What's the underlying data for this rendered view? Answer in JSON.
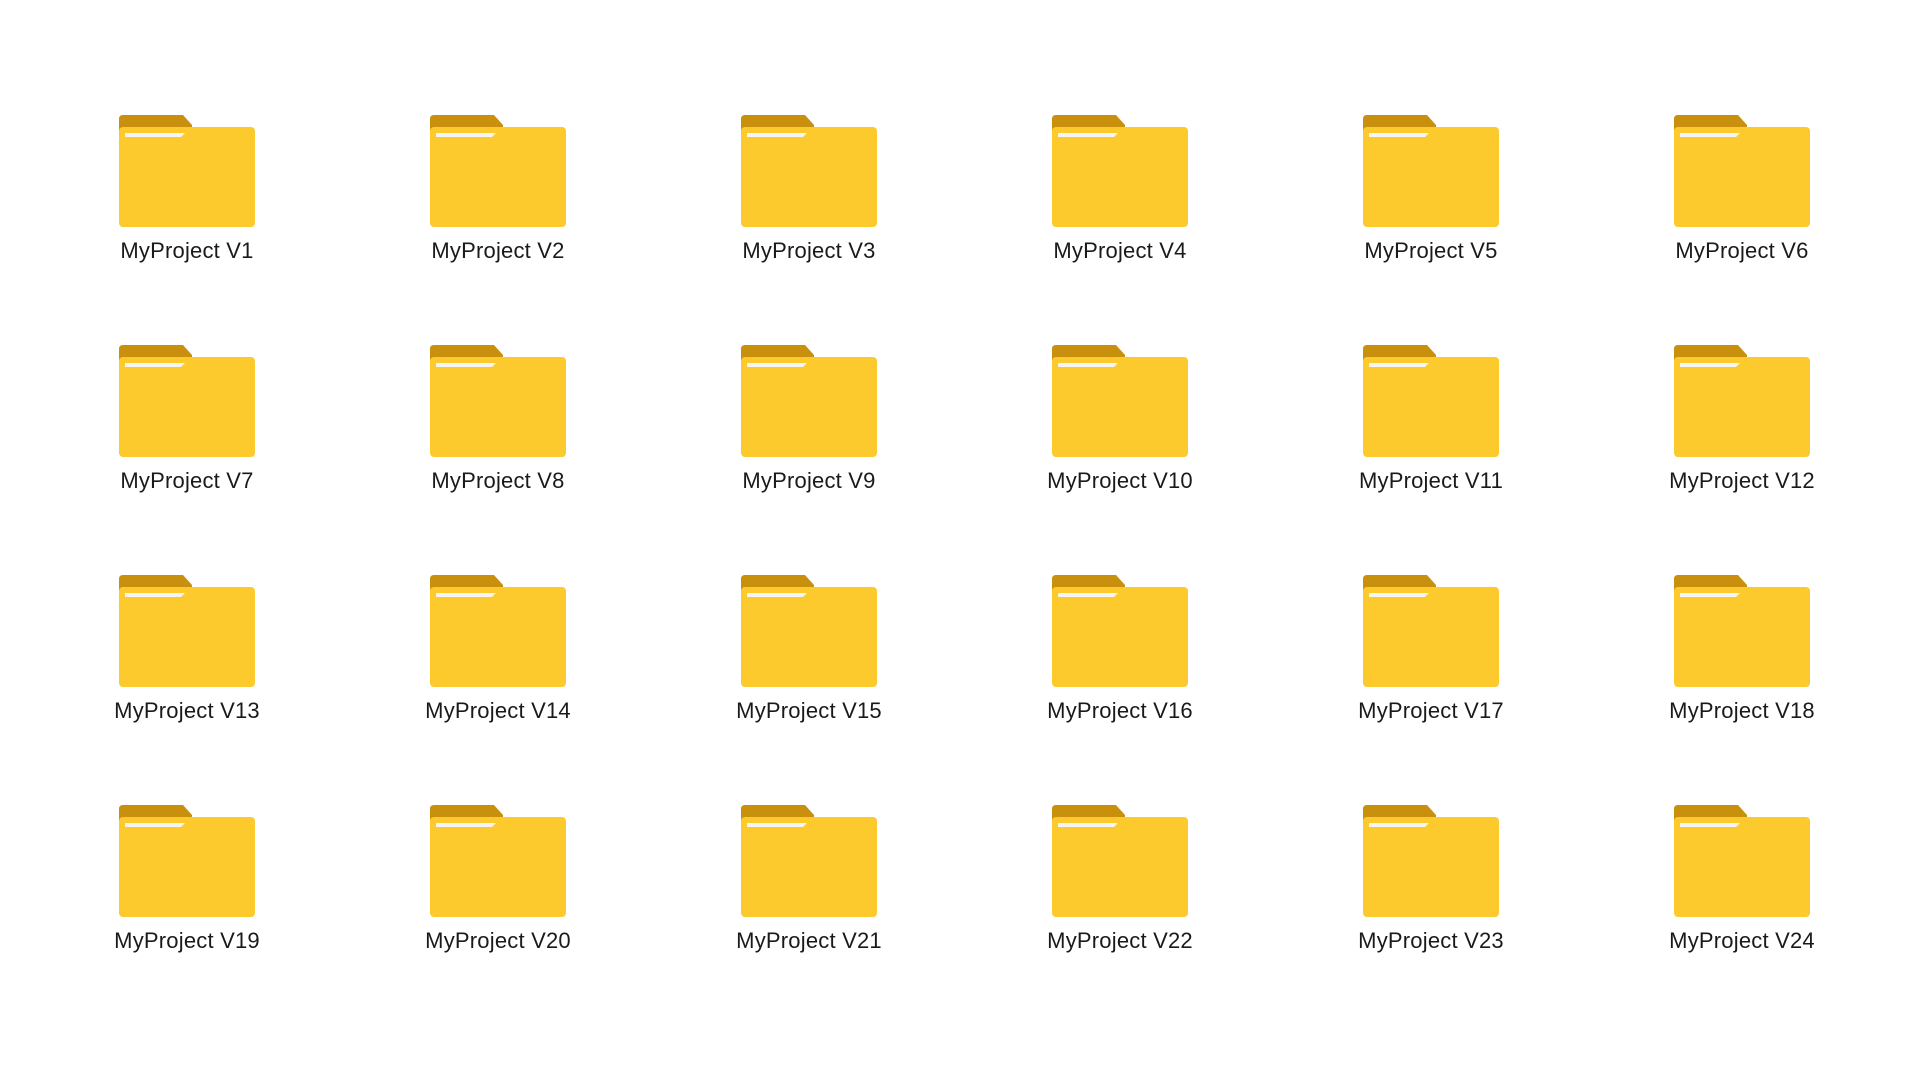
{
  "icon": "folder-icon",
  "colors": {
    "folder_front": "#FDCA2E",
    "folder_tab": "#C9900E",
    "paper": "#F4F4F4",
    "label_text": "#1A1A1A",
    "background": "#FFFFFF"
  },
  "folders": [
    {
      "label": "MyProject V1"
    },
    {
      "label": "MyProject V2"
    },
    {
      "label": "MyProject V3"
    },
    {
      "label": "MyProject V4"
    },
    {
      "label": "MyProject V5"
    },
    {
      "label": "MyProject V6"
    },
    {
      "label": "MyProject V7"
    },
    {
      "label": "MyProject V8"
    },
    {
      "label": "MyProject V9"
    },
    {
      "label": "MyProject V10"
    },
    {
      "label": "MyProject V11"
    },
    {
      "label": "MyProject V12"
    },
    {
      "label": "MyProject V13"
    },
    {
      "label": "MyProject V14"
    },
    {
      "label": "MyProject V15"
    },
    {
      "label": "MyProject V16"
    },
    {
      "label": "MyProject V17"
    },
    {
      "label": "MyProject V18"
    },
    {
      "label": "MyProject V19"
    },
    {
      "label": "MyProject V20"
    },
    {
      "label": "MyProject V21"
    },
    {
      "label": "MyProject V22"
    },
    {
      "label": "MyProject V23"
    },
    {
      "label": "MyProject V24"
    }
  ]
}
